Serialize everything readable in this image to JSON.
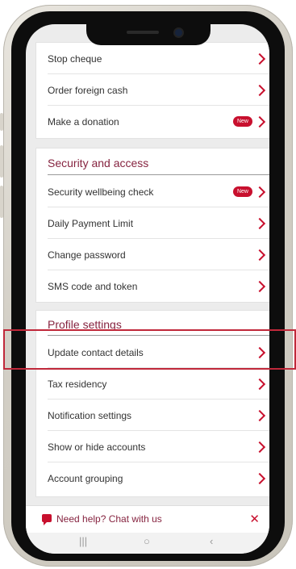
{
  "section_top": {
    "items": [
      {
        "label": "Stop cheque",
        "badge": ""
      },
      {
        "label": "Order foreign cash",
        "badge": ""
      },
      {
        "label": "Make a donation",
        "badge": "New"
      }
    ]
  },
  "security": {
    "title": "Security and access",
    "items": [
      {
        "label": "Security wellbeing check",
        "badge": "New"
      },
      {
        "label": "Daily Payment Limit",
        "badge": ""
      },
      {
        "label": "Change password",
        "badge": ""
      },
      {
        "label": "SMS code and token",
        "badge": ""
      }
    ]
  },
  "profile": {
    "title": "Profile settings",
    "items": [
      {
        "label": "Update contact details",
        "badge": ""
      },
      {
        "label": "Tax residency",
        "badge": ""
      },
      {
        "label": "Notification settings",
        "badge": ""
      },
      {
        "label": "Show or hide accounts",
        "badge": ""
      },
      {
        "label": "Account grouping",
        "badge": ""
      }
    ]
  },
  "chat": {
    "label": "Need help? Chat with us",
    "close_icon": "close-icon"
  },
  "nav": {
    "recents": "|||",
    "home": "○",
    "back": "‹"
  },
  "colors": {
    "accent": "#c8102e",
    "title": "#862440",
    "highlight": "#c0283a"
  }
}
